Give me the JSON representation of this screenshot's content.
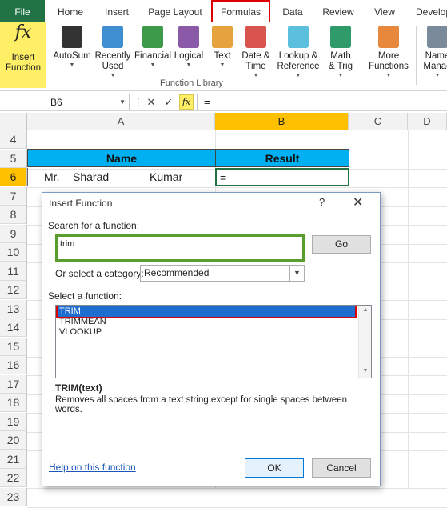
{
  "ribbon_tabs": [
    "File",
    "Home",
    "Insert",
    "Page Layout",
    "Formulas",
    "Data",
    "Review",
    "View",
    "Develop"
  ],
  "active_tab": "Formulas",
  "ribbon": {
    "insert_function": [
      "Insert",
      "Function"
    ],
    "buttons": [
      {
        "line1": "AutoSum",
        "line2": "",
        "icon": "sigma-icon",
        "color": "#333333"
      },
      {
        "line1": "Recently",
        "line2": "Used",
        "icon": "recently-used-book-icon",
        "color": "#3f8fd0"
      },
      {
        "line1": "Financial",
        "line2": "",
        "icon": "financial-book-icon",
        "color": "#3c9a4a"
      },
      {
        "line1": "Logical",
        "line2": "",
        "icon": "logical-book-icon",
        "color": "#8a5aa8"
      },
      {
        "line1": "Text",
        "line2": "",
        "icon": "text-book-icon",
        "color": "#e6a23c"
      },
      {
        "line1": "Date &",
        "line2": "Time",
        "icon": "date-time-book-icon",
        "color": "#d9534f"
      },
      {
        "line1": "Lookup &",
        "line2": "Reference",
        "icon": "lookup-book-icon",
        "color": "#5bc0de"
      },
      {
        "line1": "Math",
        "line2": "& Trig",
        "icon": "math-book-icon",
        "color": "#2f9a6a"
      },
      {
        "line1": "More",
        "line2": "Functions",
        "icon": "more-functions-icon",
        "color": "#e8883c"
      },
      {
        "line1": "Name",
        "line2": "Manag",
        "icon": "name-manager-icon",
        "color": "#7a8a9a"
      }
    ],
    "group_label": "Function Library"
  },
  "formula_bar": {
    "name_box": "B6",
    "formula": "="
  },
  "sheet": {
    "columns": [
      "A",
      "B",
      "C",
      "D"
    ],
    "selected_column": "B",
    "rows": [
      "4",
      "5",
      "6",
      "7",
      "8",
      "9",
      "10",
      "11",
      "12",
      "13",
      "14",
      "15",
      "16",
      "17",
      "18",
      "19",
      "20",
      "21",
      "22",
      "23"
    ],
    "selected_row": "6",
    "header_name": "Name",
    "header_result": "Result",
    "name_parts": [
      "Mr.",
      "Sharad",
      "Kumar"
    ],
    "result_value": "="
  },
  "dialog": {
    "title": "Insert Function",
    "help_glyph": "?",
    "close_glyph": "✕",
    "search_label": "Search for a function:",
    "search_value": "trim",
    "go_label": "Go",
    "category_label": "Or select a category:",
    "category_value": "Recommended",
    "select_label": "Select a function:",
    "functions": [
      "TRIM",
      "TRIMMEAN",
      "VLOOKUP"
    ],
    "selected_function": "TRIM",
    "signature": "TRIM(text)",
    "description": "Removes all spaces from a text string except for single spaces between words.",
    "help_link": "Help on this function",
    "ok_label": "OK",
    "cancel_label": "Cancel"
  }
}
